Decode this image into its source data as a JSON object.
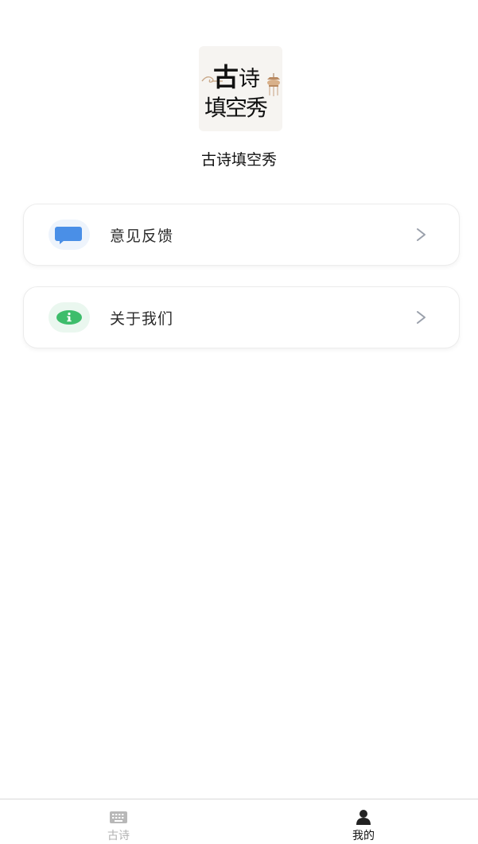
{
  "logo": {
    "line1_big": "古",
    "line1_small": "诗",
    "line2": "填空秀"
  },
  "app_name": "古诗填空秀",
  "menu": [
    {
      "label": "意见反馈",
      "icon": "feedback-chat-icon",
      "icon_color": "#4a8fe7",
      "icon_bg": "#eef4fc"
    },
    {
      "label": "关于我们",
      "icon": "info-icon",
      "icon_color": "#3dbd6b",
      "icon_bg": "#eaf7ef"
    }
  ],
  "tabbar": {
    "tabs": [
      {
        "label": "古诗",
        "icon": "keyboard-icon",
        "active": false,
        "color": "#b3b3b3"
      },
      {
        "label": "我的",
        "icon": "user-icon",
        "active": true,
        "color": "#111111"
      }
    ]
  },
  "colors": {
    "chevron": "#9aa0ab",
    "card_border": "#ececec"
  }
}
